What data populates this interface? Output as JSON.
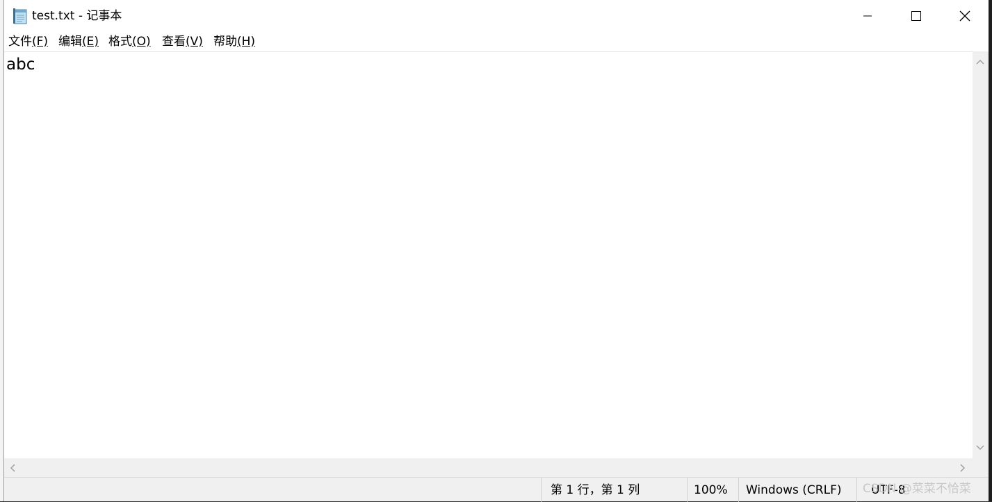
{
  "window": {
    "app_icon": "notepad-icon",
    "title": "test.txt - 记事本",
    "controls": {
      "minimize_icon": "minimize-icon",
      "maximize_icon": "maximize-icon",
      "close_icon": "close-icon"
    }
  },
  "menu": {
    "items": [
      {
        "label": "文件",
        "accel": "(F)"
      },
      {
        "label": "编辑",
        "accel": "(E)"
      },
      {
        "label": "格式",
        "accel": "(O)"
      },
      {
        "label": "查看",
        "accel": "(V)"
      },
      {
        "label": "帮助",
        "accel": "(H)"
      }
    ]
  },
  "editor": {
    "content": "abc"
  },
  "status_bar": {
    "position": "第 1 行，第 1 列",
    "zoom": "100%",
    "line_endings": "Windows (CRLF)",
    "encoding": "UTF-8"
  },
  "watermark": "CSDN @菜菜不恰菜",
  "colors": {
    "window_bg": "#ffffff",
    "chrome_bg": "#f0f0f0",
    "text": "#000000"
  }
}
